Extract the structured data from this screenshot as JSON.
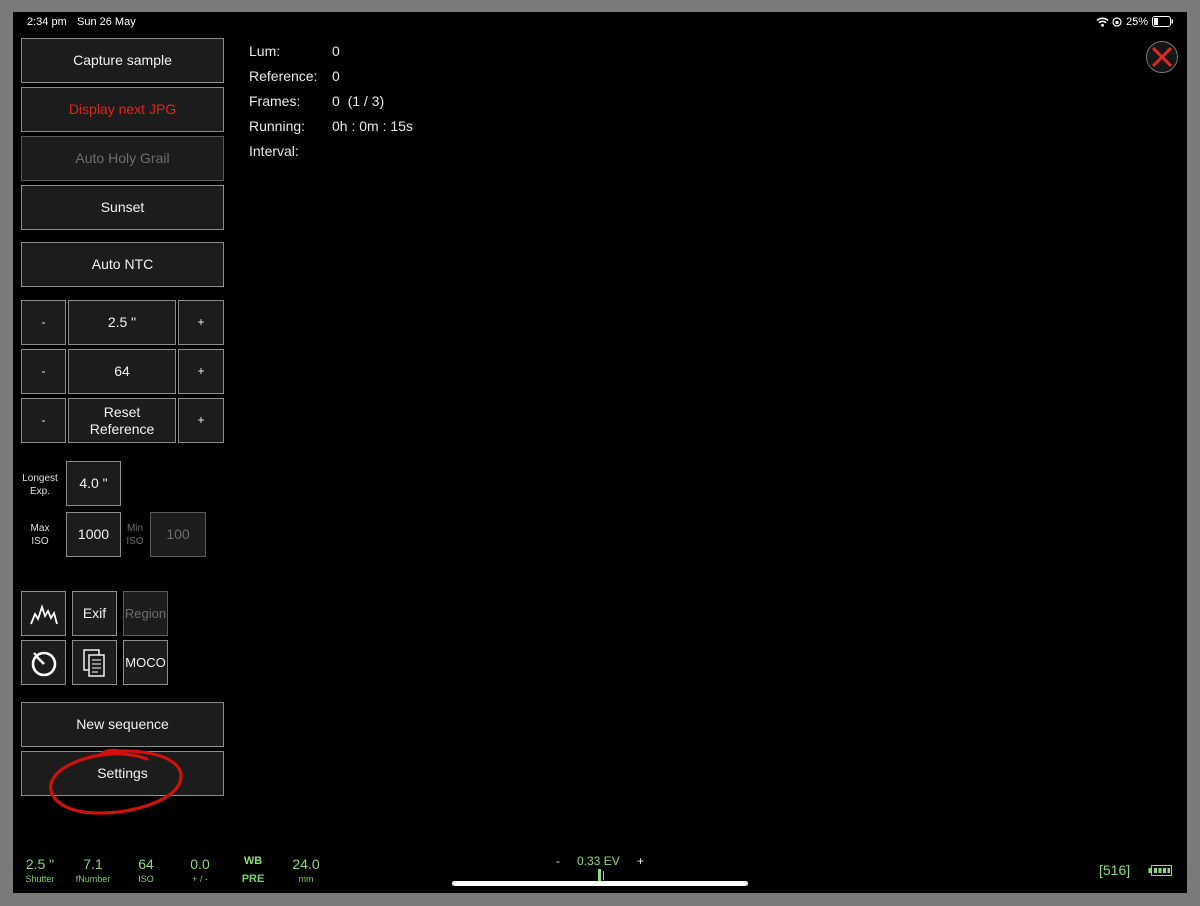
{
  "status_bar": {
    "time": "2:34 pm",
    "date": "Sun 26 May",
    "battery_percent": "25%"
  },
  "buttons": {
    "capture_sample": "Capture sample",
    "display_next_jpg": "Display next JPG",
    "auto_holy_grail": "Auto Holy Grail",
    "sunset": "Sunset",
    "auto_ntc": "Auto NTC",
    "minus": "-",
    "plus": "+",
    "shutter_value": "2.5 \"",
    "iso_value": "64",
    "reset_reference": "Reset Reference",
    "new_sequence": "New sequence",
    "settings": "Settings"
  },
  "exposure_limits": {
    "longest_exp_label": "Longest Exp.",
    "longest_exp_value": "4.0 \"",
    "max_iso_label": "Max ISO",
    "max_iso_value": "1000",
    "min_iso_label": "Min ISO",
    "min_iso_value": "100"
  },
  "tools": {
    "exif": "Exif",
    "region": "Region",
    "moco": "MOCO"
  },
  "info": {
    "lum_label": "Lum:",
    "lum_value": "0",
    "reference_label": "Reference:",
    "reference_value": "0",
    "frames_label": "Frames:",
    "frames_value": "0  (1 / 3)",
    "running_label": "Running:",
    "running_value": "0h : 0m : 15s",
    "interval_label": "Interval:",
    "interval_value": ""
  },
  "bottom_bar": {
    "shutter_value": "2.5 \"",
    "shutter_label": "Shutter",
    "fnumber_value": "7.1",
    "fnumber_label": "fNumber",
    "iso_value": "64",
    "iso_label": "ISO",
    "ev_comp_value": "0.0",
    "ev_comp_label": "+ / -",
    "wb_value": "WB",
    "wb_label": "PRE",
    "focal_value": "24.0",
    "focal_label": "mm",
    "ev_minus": "-",
    "ev_value": "0.33 EV",
    "ev_plus": "+",
    "counter": "[516]"
  },
  "colors": {
    "accent_green": "#8fdc7a",
    "warning_red": "#e4241e",
    "close_red": "#e02a20"
  }
}
